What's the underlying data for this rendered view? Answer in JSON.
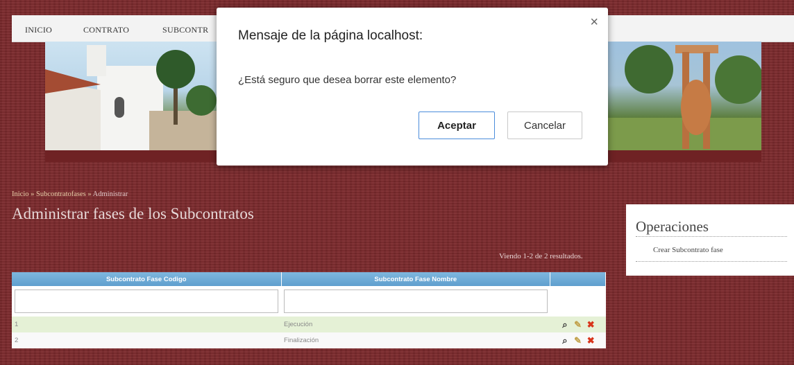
{
  "nav": {
    "items": [
      "INICIO",
      "CONTRATO",
      "SUBCONTR"
    ]
  },
  "breadcrumb": {
    "home": "Inicio",
    "section": "Subcontratofases",
    "current": "Administrar",
    "sep": "»"
  },
  "page": {
    "title": "Administrar fases de los Subcontratos",
    "summary": "Viendo 1-2 de 2 resultados."
  },
  "table": {
    "headers": [
      "Subcontrato Fase Codigo",
      "Subcontrato Fase Nombre",
      ""
    ],
    "rows": [
      {
        "codigo": "1",
        "nombre": "Ejecución"
      },
      {
        "codigo": "2",
        "nombre": "Finalización"
      }
    ]
  },
  "operations": {
    "title": "Operaciones",
    "links": [
      "Crear Subcontrato fase"
    ]
  },
  "dialog": {
    "title": "Mensaje de la página localhost:",
    "message": "¿Está seguro que desea borrar este elemento?",
    "ok": "Aceptar",
    "cancel": "Cancelar",
    "close": "×"
  },
  "colors": {
    "background": "#7c2a2d",
    "header": "#6ea9d6",
    "odd_row": "#e5f1d6"
  },
  "icons": {
    "view": "magnifier-icon",
    "update": "pencil-icon",
    "delete": "cross-icon"
  }
}
